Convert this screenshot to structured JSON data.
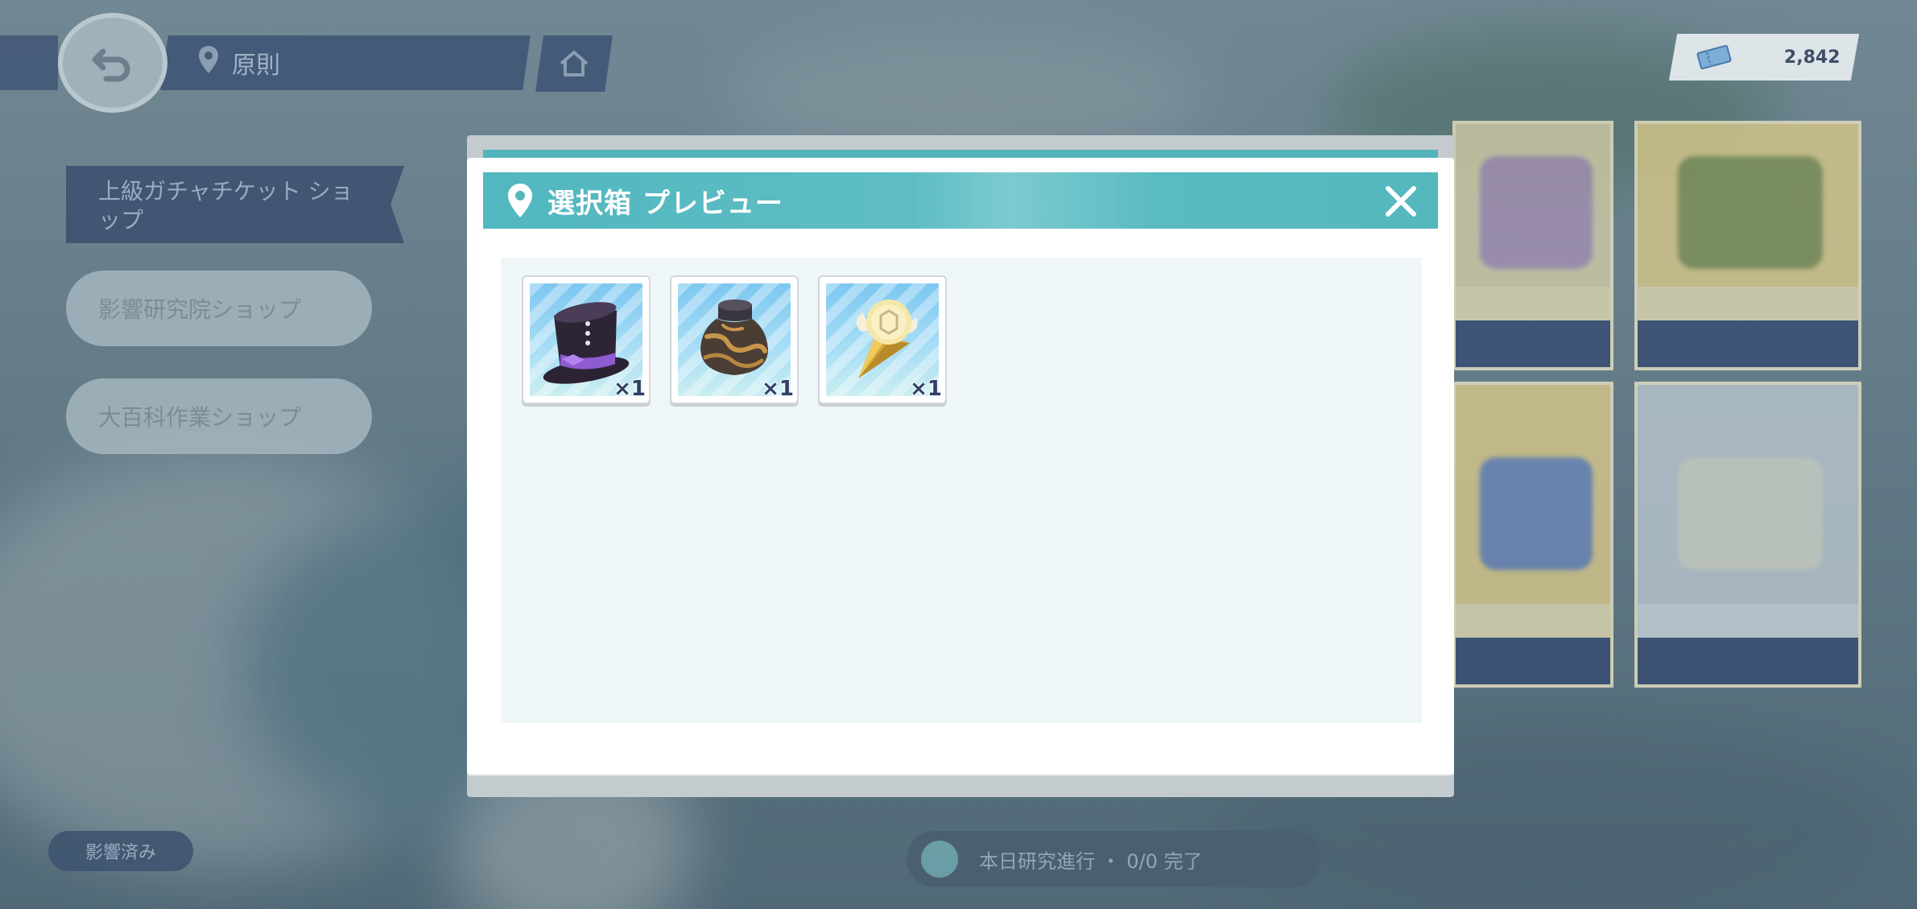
{
  "background": {
    "location_label": "原則",
    "side_banner_text": "上級ガチャチケット ショップ",
    "side_pills": [
      "影響研究院ショップ",
      "大百科作業ショップ"
    ],
    "bottom_left_tag": "影響済み",
    "bottom_center_text": "本日研究進行 ・ 0/0 完了"
  },
  "currency": {
    "icon": "ticket-icon",
    "value": "2,842"
  },
  "modal": {
    "title": "選択箱 プレビュー",
    "pin_icon": "location-pin-icon",
    "close_icon": "close-icon",
    "accent_color": "#52b7bf",
    "items": [
      {
        "icon": "top-hat-icon",
        "quantity": "×1"
      },
      {
        "icon": "rock-sack-icon",
        "quantity": "×1"
      },
      {
        "icon": "golden-orb-icon",
        "quantity": "×1"
      }
    ]
  }
}
